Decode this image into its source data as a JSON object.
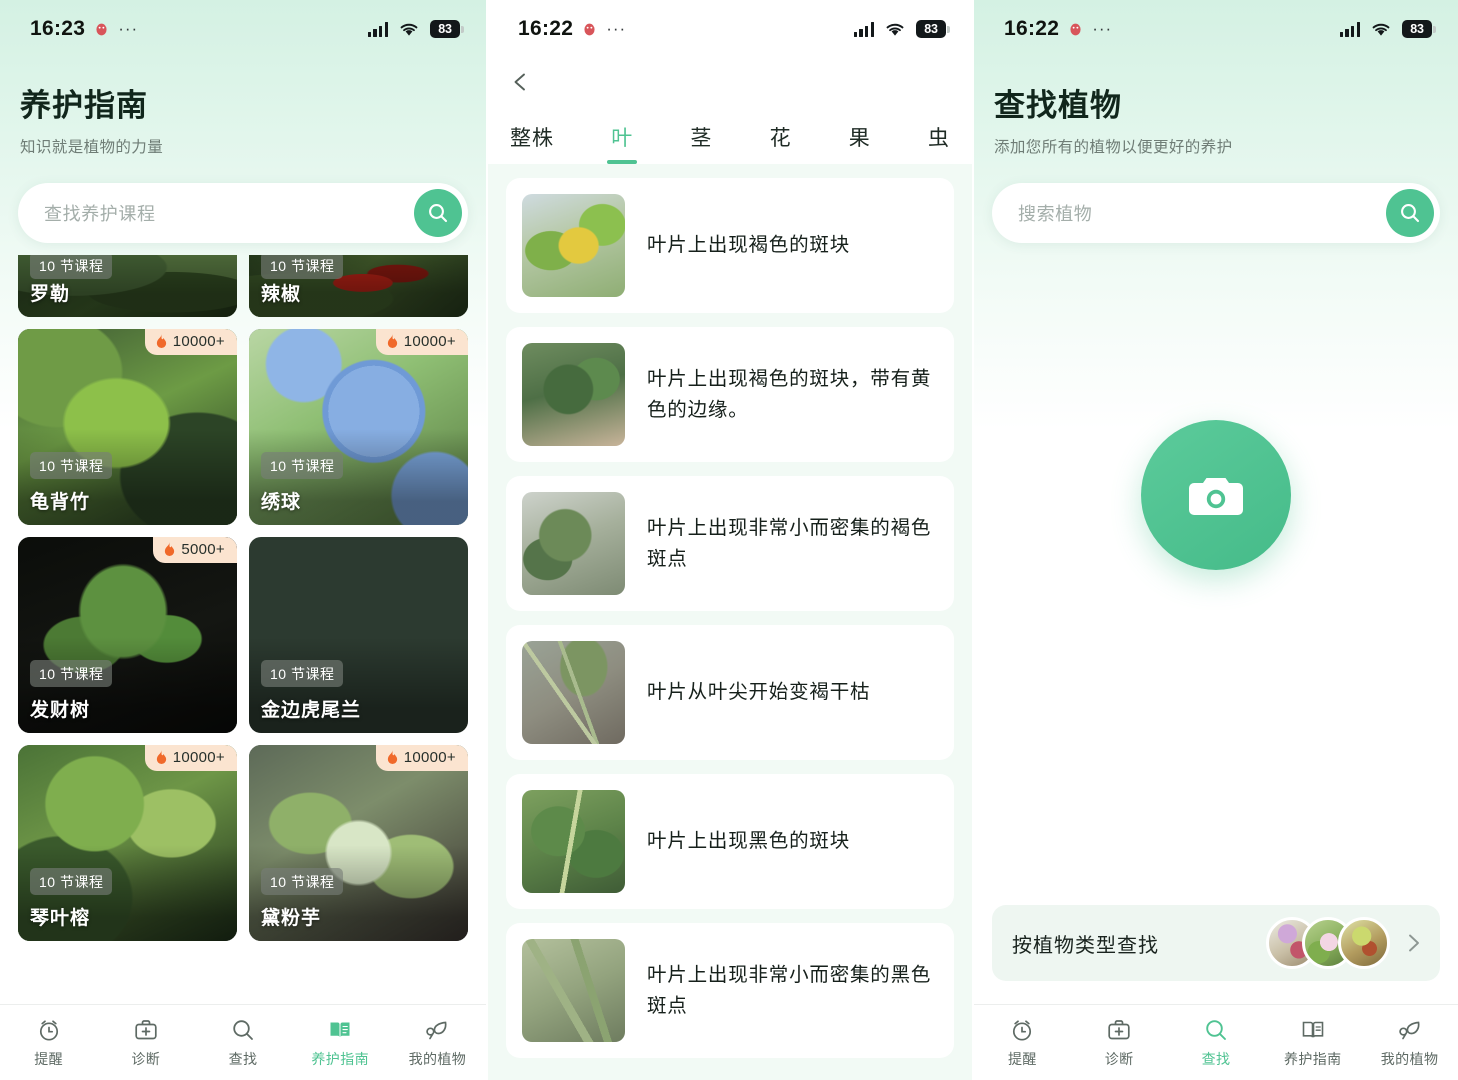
{
  "screens": [
    {
      "status": {
        "time": "16:23",
        "battery": "83",
        "icons": [
          "qq-icon",
          "more-dots-icon",
          "signal-icon",
          "wifi-icon",
          "battery-icon"
        ]
      },
      "header": {
        "title": "养护指南",
        "subtitle": "知识就是植物的力量"
      },
      "search": {
        "placeholder": "查找养护课程",
        "icon": "search-icon"
      },
      "cards": [
        {
          "name": "罗勒",
          "lessons": "10 节课程",
          "hot": "",
          "clipped": true
        },
        {
          "name": "辣椒",
          "lessons": "10 节课程",
          "hot": "",
          "clipped": true
        },
        {
          "name": "龟背竹",
          "lessons": "10 节课程",
          "hot": "10000+",
          "clipped": false
        },
        {
          "name": "绣球",
          "lessons": "10 节课程",
          "hot": "10000+",
          "clipped": false
        },
        {
          "name": "发财树",
          "lessons": "10 节课程",
          "hot": "5000+",
          "clipped": false
        },
        {
          "name": "金边虎尾兰",
          "lessons": "10 节课程",
          "hot": "",
          "clipped": false
        },
        {
          "name": "琴叶榕",
          "lessons": "10 节课程",
          "hot": "10000+",
          "clipped": false
        },
        {
          "name": "黛粉芋",
          "lessons": "10 节课程",
          "hot": "10000+",
          "clipped": false
        }
      ],
      "tabbar": [
        {
          "label": "提醒",
          "icon": "alarm-clock-icon",
          "active": false
        },
        {
          "label": "诊断",
          "icon": "first-aid-kit-icon",
          "active": false
        },
        {
          "label": "查找",
          "icon": "search-icon",
          "active": false
        },
        {
          "label": "养护指南",
          "icon": "book-icon",
          "active": true
        },
        {
          "label": "我的植物",
          "icon": "leaf-icon",
          "active": false
        }
      ]
    },
    {
      "status": {
        "time": "16:22",
        "battery": "83"
      },
      "back_icon": "chevron-left-icon",
      "tabs": [
        {
          "label": "整株",
          "active": false
        },
        {
          "label": "叶",
          "active": true
        },
        {
          "label": "茎",
          "active": false
        },
        {
          "label": "花",
          "active": false
        },
        {
          "label": "果",
          "active": false
        },
        {
          "label": "虫",
          "active": false
        }
      ],
      "symptoms": [
        {
          "text": "叶片上出现褐色的斑块"
        },
        {
          "text": "叶片上出现褐色的斑块，带有黄色的边缘。"
        },
        {
          "text": "叶片上出现非常小而密集的褐色斑点"
        },
        {
          "text": "叶片从叶尖开始变褐干枯"
        },
        {
          "text": "叶片上出现黑色的斑块"
        },
        {
          "text": "叶片上出现非常小而密集的黑色斑点"
        }
      ]
    },
    {
      "status": {
        "time": "16:22",
        "battery": "83"
      },
      "header": {
        "title": "查找植物",
        "subtitle": "添加您所有的植物以便更好的养护"
      },
      "search": {
        "placeholder": "搜索植物",
        "icon": "search-icon"
      },
      "camera": {
        "icon": "camera-icon"
      },
      "type_card": {
        "label": "按植物类型查找",
        "chevron": "chevron-right-icon",
        "avatars": 3
      },
      "tabbar": [
        {
          "label": "提醒",
          "icon": "alarm-clock-icon",
          "active": false
        },
        {
          "label": "诊断",
          "icon": "first-aid-kit-icon",
          "active": false
        },
        {
          "label": "查找",
          "icon": "search-icon",
          "active": true
        },
        {
          "label": "养护指南",
          "icon": "book-icon",
          "active": false
        },
        {
          "label": "我的植物",
          "icon": "leaf-icon",
          "active": false
        }
      ]
    }
  ],
  "colors": {
    "accent": "#4fc392",
    "hot_badge_bg": "#fbe4d0",
    "flame": "#f0692a",
    "mint_top": "#d4f1e3",
    "panel2_bg": "#f2faf5"
  }
}
